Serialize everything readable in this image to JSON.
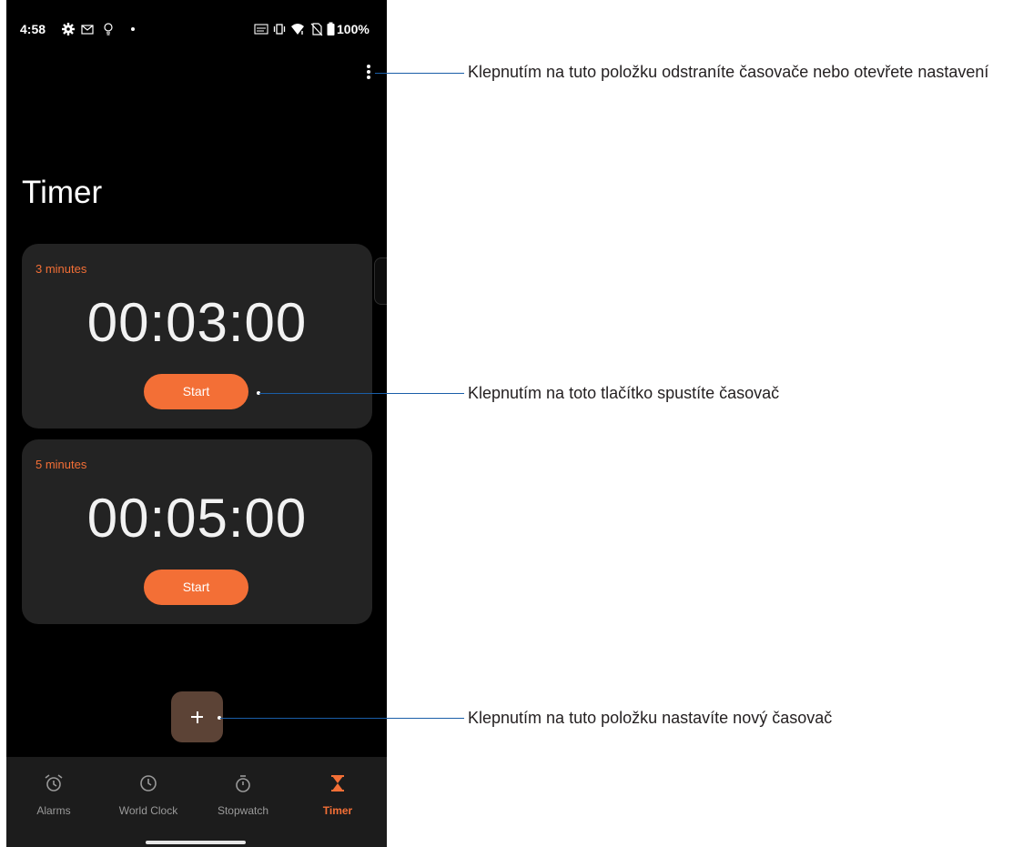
{
  "status_bar": {
    "time": "4:58",
    "battery": "100%",
    "icons": [
      "settings-icon",
      "mail-icon",
      "bulb-icon",
      "dot-icon",
      "volte-icon",
      "vibrate-icon",
      "wifi-icon",
      "no-sim-icon",
      "battery-icon"
    ]
  },
  "header": {
    "title": "Timer",
    "menu_icon": "more-vert-icon"
  },
  "timers": [
    {
      "label": "3 minutes",
      "time": "00:03:00",
      "button": "Start"
    },
    {
      "label": "5 minutes",
      "time": "00:05:00",
      "button": "Start"
    }
  ],
  "fab": {
    "icon": "plus-icon"
  },
  "bottom_nav": {
    "items": [
      {
        "label": "Alarms",
        "icon": "alarm-icon",
        "active": false
      },
      {
        "label": "World Clock",
        "icon": "clock-icon",
        "active": false
      },
      {
        "label": "Stopwatch",
        "icon": "stopwatch-icon",
        "active": false
      },
      {
        "label": "Timer",
        "icon": "hourglass-icon",
        "active": true
      }
    ]
  },
  "callouts": {
    "menu": "Klepnutím na tuto položku odstraníte časovače nebo otevřete nastavení",
    "start": "Klepnutím na toto tlačítko spustíte časovač",
    "add": "Klepnutím na tuto položku nastavíte nový časovač"
  },
  "colors": {
    "accent": "#f36f36",
    "card": "#232323",
    "fab": "#5c4336",
    "callout_line": "#1a5ea8"
  }
}
